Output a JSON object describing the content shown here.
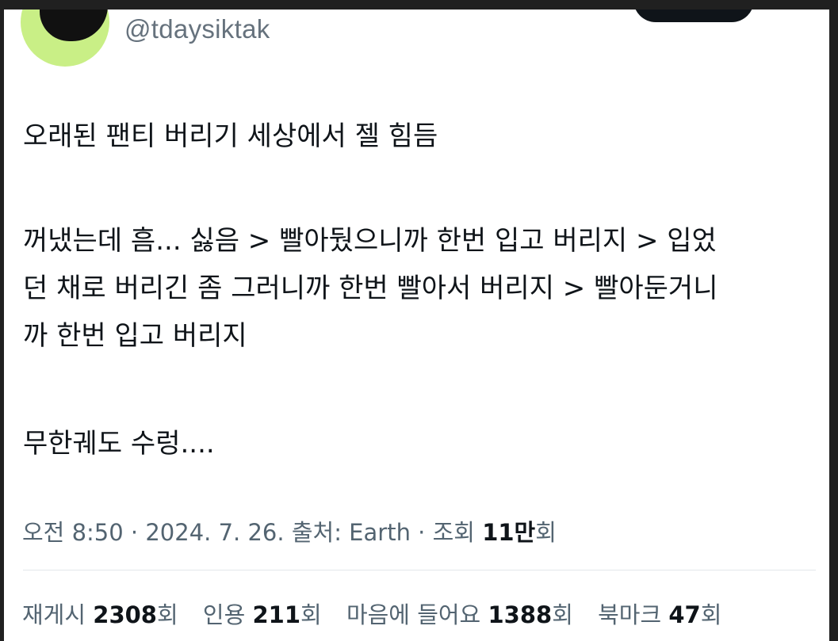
{
  "author": {
    "handle": "@tdaysiktak",
    "avatar_icon": "black-cat-avatar",
    "avatar_bg_color": "#c9ef86"
  },
  "tweet": {
    "line1": "오래된 팬티 버리기 세상에서 젤 힘듬",
    "line2": "꺼냈는데 흠... 싫음 > 빨아뒀으니까 한번 입고 버리지 > 입었",
    "line3": "던 채로 버리긴 좀 그러니까 한번 빨아서 버리지 > 빨아둔거니",
    "line4": "까 한번 입고 버리지",
    "line5": "무한궤도 수렁...."
  },
  "meta": {
    "time": "오전 8:50",
    "date": "2024. 7. 26.",
    "source": "출처: Earth",
    "views_label": "조회",
    "views_value": "11만",
    "views_suffix": "회"
  },
  "stats": {
    "retweets_label": "재게시",
    "retweets_value": "2308",
    "retweets_suffix": "회",
    "quotes_label": "인용",
    "quotes_value": "211",
    "quotes_suffix": "회",
    "likes_label": "마음에 들어요",
    "likes_value": "1388",
    "likes_suffix": "회",
    "bookmarks_label": "북마크",
    "bookmarks_value": "47",
    "bookmarks_suffix": "회"
  },
  "colors": {
    "text_primary": "#0f1419",
    "text_secondary": "#536471",
    "divider": "#e3e7ea"
  }
}
